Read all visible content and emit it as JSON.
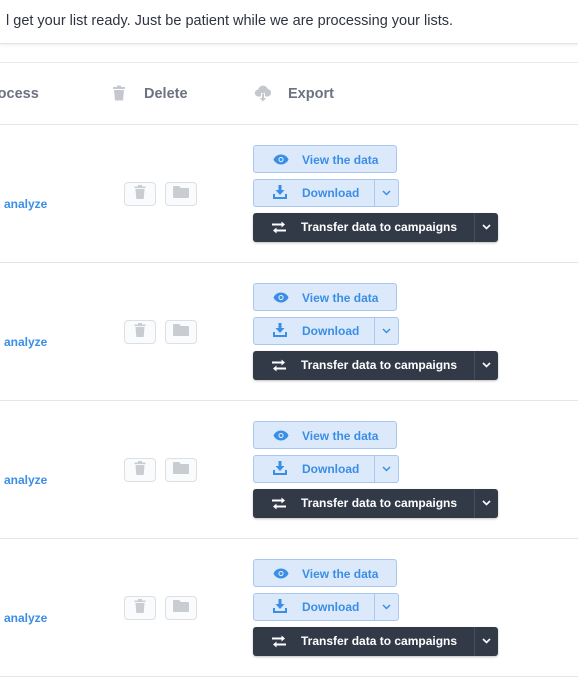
{
  "notice": {
    "text": "l get your list ready. Just be patient while we are processing your lists."
  },
  "table": {
    "headers": {
      "process": "rocess",
      "delete": "Delete",
      "export": "Export"
    },
    "rows": [
      {
        "analyze": "analyze",
        "view": "View the data",
        "download": "Download",
        "transfer": "Transfer data to campaigns"
      },
      {
        "analyze": "analyze",
        "view": "View the data",
        "download": "Download",
        "transfer": "Transfer data to campaigns"
      },
      {
        "analyze": "analyze",
        "view": "View the data",
        "download": "Download",
        "transfer": "Transfer data to campaigns"
      },
      {
        "analyze": "analyze",
        "view": "View the data",
        "download": "Download",
        "transfer": "Transfer data to campaigns"
      }
    ]
  },
  "icons": {
    "header_delete": "trash-icon",
    "header_export": "cloud-download-icon",
    "row_delete": "trash-icon",
    "row_folder": "folder-icon",
    "view": "eye-icon",
    "download": "download-icon",
    "transfer": "transfer-arrows-icon",
    "dropdown": "chevron-down-icon"
  },
  "colors": {
    "accent": "#3a8ee6",
    "light_button_bg": "#dce9fb",
    "dark_button_bg": "#323a48"
  }
}
